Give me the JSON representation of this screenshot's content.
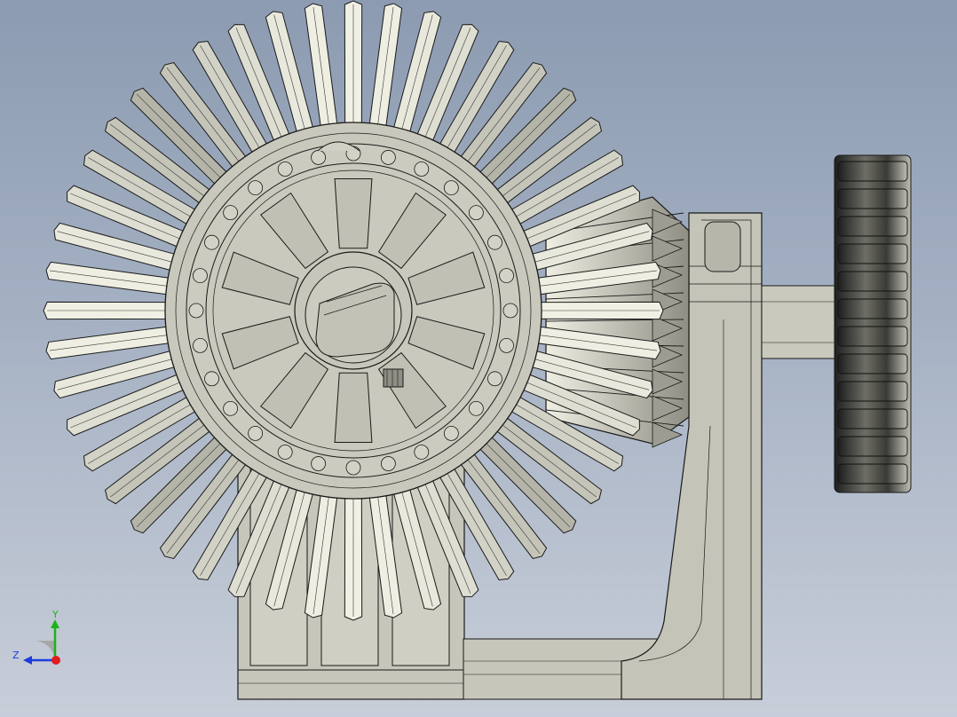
{
  "viewport": {
    "background_top": "#8c9bb1",
    "background_bottom": "#c8ced9",
    "model_face_color": "#c9c9bd",
    "edge_color": "#1a1a1a",
    "highlight_color": "#f4f4ea"
  },
  "triad": {
    "y_label": "Y",
    "z_label": "Z",
    "y_color": "#19b419",
    "z_color": "#1e3cdc",
    "x_color": "#e01e1e"
  },
  "model": {
    "parts": [
      "large-bevel-gear",
      "bevel-pinion",
      "spur-gear",
      "bearing-hub",
      "support-bracket",
      "base-housing"
    ]
  }
}
